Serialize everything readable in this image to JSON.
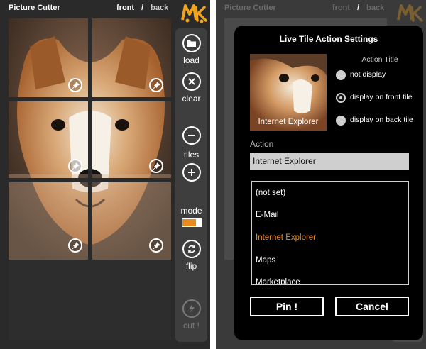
{
  "app": {
    "title": "Picture Cutter",
    "nav_front": "front",
    "nav_separator": "/",
    "nav_back": "back",
    "logo_text": "MK"
  },
  "left": {
    "sidebar": {
      "load_label": "load",
      "clear_label": "clear",
      "tiles_label": "tiles",
      "mode_label": "mode",
      "flip_label": "flip",
      "cut_label": "cut !"
    }
  },
  "dialog": {
    "title": "Live Tile Action Settings",
    "tile_label": "Internet Explorer",
    "action_title_heading": "Action Title",
    "options": [
      {
        "label": "not display",
        "selected": false
      },
      {
        "label": "display on front tile",
        "selected": true
      },
      {
        "label": "display on back tile",
        "selected": false
      }
    ],
    "action_label": "Action",
    "action_value": "Internet Explorer",
    "actions": [
      "(not set)",
      "E-Mail",
      "Internet Explorer",
      "Maps",
      "Marketplace"
    ],
    "selected_action": "Internet Explorer",
    "pin_label": "Pin !",
    "cancel_label": "Cancel"
  },
  "colors": {
    "accent": "#e8892a",
    "background": "#2a2a2a",
    "dialog": "#000000"
  }
}
